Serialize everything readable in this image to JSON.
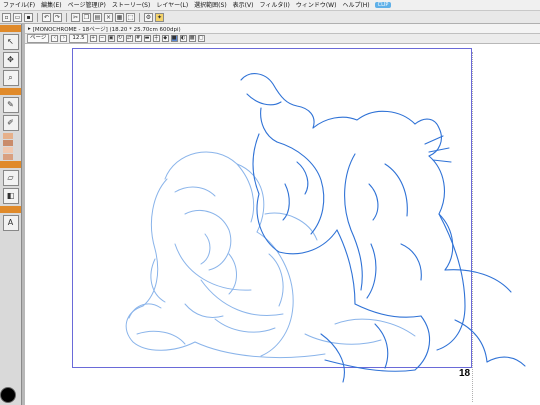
{
  "menubar": {
    "items": [
      "ファイル(F)",
      "編集(E)",
      "ページ管理(P)",
      "ストーリー(S)",
      "レイヤー(L)",
      "選択範囲(S)",
      "表示(V)",
      "フィルタ(I)",
      "ウィンドウ(W)",
      "ヘルプ(H)"
    ],
    "badge": "CLIP"
  },
  "toolbar": {
    "buttons": [
      "new",
      "open",
      "save",
      "undo",
      "redo",
      "cut",
      "copy",
      "paste",
      "clear",
      "fill",
      "transform",
      "settings",
      "clip-studio"
    ]
  },
  "document": {
    "title": "[MONOCHROME - 18ページ] (18.20 * 25.70cm 600dpi)",
    "toolbar_view_label": "ページ",
    "toolbar_zoom": "12.5",
    "page_number": "18"
  },
  "colors": {
    "sketch_light": "#8ab4ea",
    "sketch_dark": "#2f72d6",
    "page_frame": "#6a6ad8",
    "panel_accent": "#e08a2a"
  }
}
